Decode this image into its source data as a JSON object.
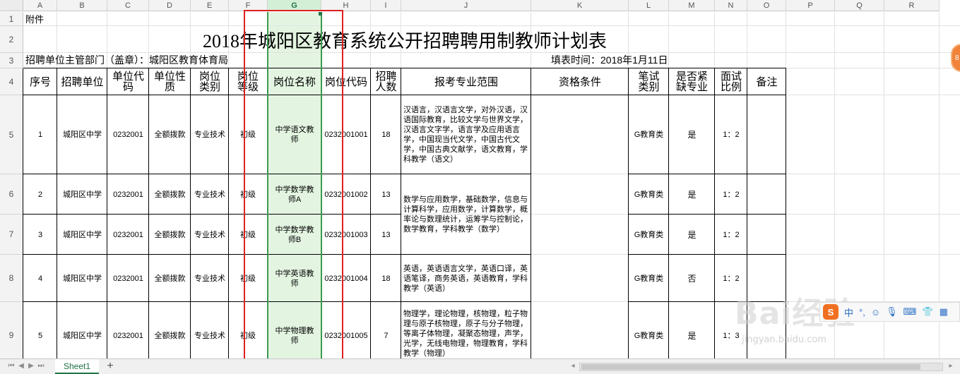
{
  "columns": [
    "A",
    "B",
    "C",
    "D",
    "E",
    "F",
    "G",
    "H",
    "I",
    "J",
    "K",
    "L",
    "M",
    "N",
    "O",
    "P",
    "Q",
    "R"
  ],
  "rows": [
    "1",
    "2",
    "3",
    "4",
    "5",
    "6",
    "7",
    "8",
    "9"
  ],
  "sheet": {
    "a1": "附件",
    "title": "2018年城阳区教育系统公开招聘聘用制教师计划表",
    "department": "招聘单位主管部门（盖章）：城阳区教育体育局",
    "fill_time": "填表时间：2018年1月11日"
  },
  "headers": {
    "seq": "序号",
    "unit": "招聘单位",
    "unit_code": "单位代码",
    "unit_nature": "单位性质",
    "post_type": "岗位类别",
    "post_level": "岗位等级",
    "post_name": "岗位名称",
    "post_code": "岗位代码",
    "hire_count": "招聘人数",
    "major_range": "报考专业范围",
    "qualification": "资格条件",
    "exam_type": "笔试类别",
    "urgent": "是否紧缺专业",
    "interview_ratio": "面试比例",
    "remark": "备注"
  },
  "records": [
    {
      "seq": "1",
      "unit": "城阳区中学",
      "unit_code": "0232001",
      "unit_nature": "全额拨款",
      "post_type": "专业技术",
      "post_level": "初级",
      "post_name": "中学语文教师",
      "post_code": "0232001001",
      "hire_count": "18",
      "major_range": "汉语言，汉语言文学，对外汉语，汉语国际教育，比较文学与世界文学，汉语言文字学，语言学及应用语言学，中国现当代文学，中国古代文学，中国古典文献学，语文教育，学科教学（语文）",
      "exam_type": "G教育类",
      "urgent": "是",
      "interview_ratio": "1：2",
      "remark": ""
    },
    {
      "seq": "2",
      "unit": "城阳区中学",
      "unit_code": "0232001",
      "unit_nature": "全额拨款",
      "post_type": "专业技术",
      "post_level": "初级",
      "post_name": "中学数学教师A",
      "post_code": "0232001002",
      "hire_count": "13",
      "exam_type": "G教育类",
      "urgent": "是",
      "interview_ratio": "1：2",
      "remark": ""
    },
    {
      "seq": "3",
      "unit": "城阳区中学",
      "unit_code": "0232001",
      "unit_nature": "全额拨款",
      "post_type": "专业技术",
      "post_level": "初级",
      "post_name": "中学数学教师B",
      "post_code": "0232001003",
      "hire_count": "13",
      "exam_type": "G教育类",
      "urgent": "是",
      "interview_ratio": "1：2",
      "remark": ""
    },
    {
      "seq": "4",
      "unit": "城阳区中学",
      "unit_code": "0232001",
      "unit_nature": "全额拨款",
      "post_type": "专业技术",
      "post_level": "初级",
      "post_name": "中学英语教师",
      "post_code": "0232001004",
      "hire_count": "18",
      "major_range": "英语，英语语言文学，英语口译，英语笔译，商务英语，英语教育，学科教学（英语）",
      "exam_type": "G教育类",
      "urgent": "否",
      "interview_ratio": "1：2",
      "remark": ""
    },
    {
      "seq": "5",
      "unit": "城阳区中学",
      "unit_code": "0232001",
      "unit_nature": "全额拨款",
      "post_type": "专业技术",
      "post_level": "初级",
      "post_name": "中学物理教师",
      "post_code": "0232001005",
      "hire_count": "7",
      "major_range": "物理学，理论物理，核物理，粒子物理与原子核物理，原子与分子物理，等离子体物理，凝聚态物理，声学，光学，无线电物理，物理教育，学科教学（物理）",
      "exam_type": "G教育类",
      "urgent": "是",
      "interview_ratio": "1：3",
      "remark": ""
    }
  ],
  "math_major_range": "数学与应用数学，基础数学，信息与计算科学，应用数学，计算数学，概率论与数理统计，运筹学与控制论，数学教育，学科教学（数学）",
  "tabs": {
    "sheet1": "Sheet1",
    "add": "+"
  },
  "watermark": {
    "brand": "Bai经验",
    "url": "jingyan.baidu.com"
  },
  "ime": {
    "logo": "S",
    "lang": "中"
  },
  "colors": {
    "accent": "#217346",
    "highlight": "#e3f5e1",
    "annotation": "#e02020"
  }
}
